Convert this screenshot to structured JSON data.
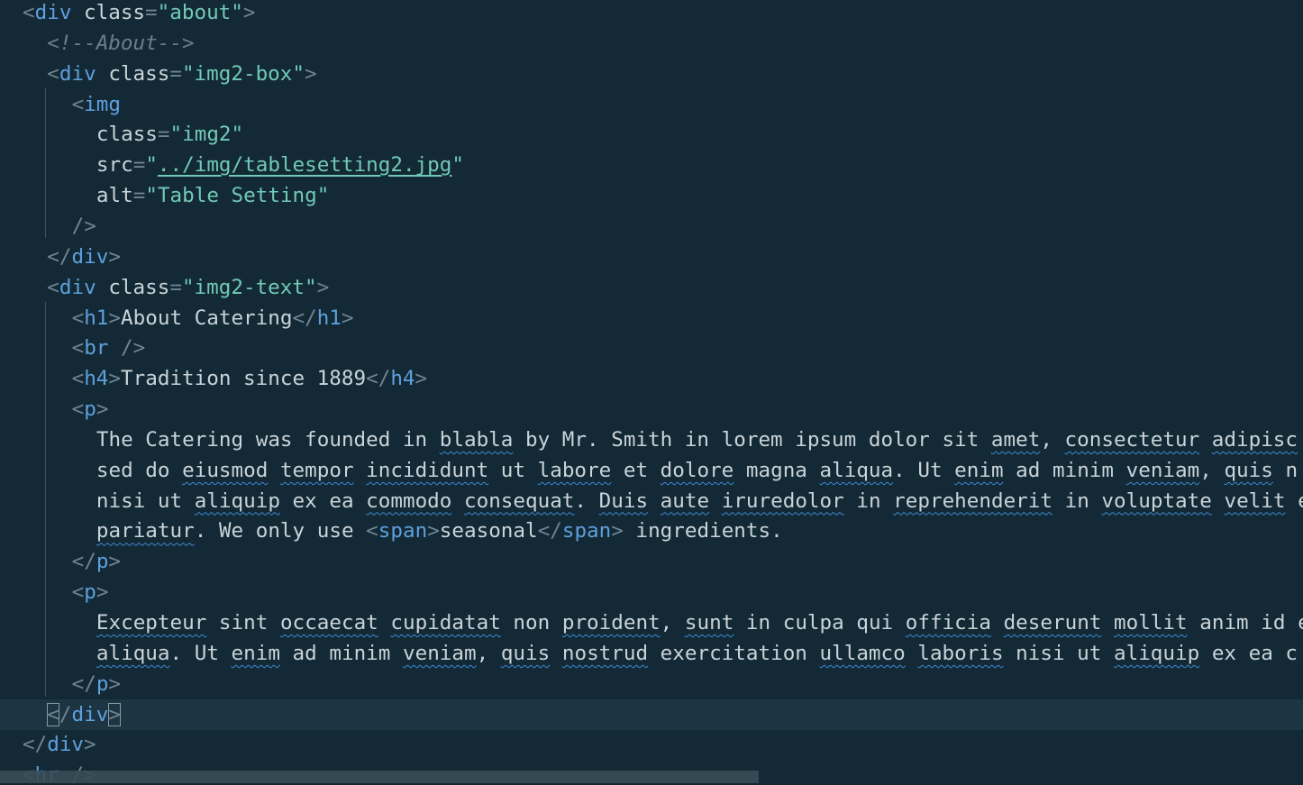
{
  "editor": {
    "language": "html",
    "colors": {
      "background": "#132935",
      "current_line": "#1d3443",
      "tag": "#5ea0dc",
      "string": "#71c9b6",
      "comment": "#6b7f89",
      "punctuation": "#6f8591",
      "text": "#c9d4d8",
      "spellcheck_squiggle": "#3d8bd6"
    },
    "lines": [
      {
        "indent": 0,
        "tokens": [
          [
            "pun",
            "<"
          ],
          [
            "tag",
            "div"
          ],
          [
            "attr",
            " class"
          ],
          [
            "pun",
            "="
          ],
          [
            "val",
            "\"about\""
          ],
          [
            "pun",
            ">"
          ]
        ]
      },
      {
        "indent": 1,
        "tokens": [
          [
            "cm",
            "<!--About-->"
          ]
        ]
      },
      {
        "indent": 1,
        "tokens": [
          [
            "pun",
            "<"
          ],
          [
            "tag",
            "div"
          ],
          [
            "attr",
            " class"
          ],
          [
            "pun",
            "="
          ],
          [
            "val",
            "\"img2-box\""
          ],
          [
            "pun",
            ">"
          ]
        ]
      },
      {
        "indent": 2,
        "tokens": [
          [
            "pun",
            "<"
          ],
          [
            "tag",
            "img"
          ]
        ]
      },
      {
        "indent": 3,
        "tokens": [
          [
            "attr",
            "class"
          ],
          [
            "pun",
            "="
          ],
          [
            "val",
            "\"img2\""
          ]
        ]
      },
      {
        "indent": 3,
        "tokens": [
          [
            "attr",
            "src"
          ],
          [
            "pun",
            "="
          ],
          [
            "val",
            "\""
          ],
          [
            "url",
            "../img/tablesetting2.jpg"
          ],
          [
            "val",
            "\""
          ]
        ]
      },
      {
        "indent": 3,
        "tokens": [
          [
            "attr",
            "alt"
          ],
          [
            "pun",
            "="
          ],
          [
            "val",
            "\"Table Setting\""
          ]
        ]
      },
      {
        "indent": 2,
        "tokens": [
          [
            "pun",
            "/>"
          ]
        ]
      },
      {
        "indent": 1,
        "tokens": [
          [
            "pun",
            "</"
          ],
          [
            "tag",
            "div"
          ],
          [
            "pun",
            ">"
          ]
        ]
      },
      {
        "indent": 1,
        "tokens": [
          [
            "pun",
            "<"
          ],
          [
            "tag",
            "div"
          ],
          [
            "attr",
            " class"
          ],
          [
            "pun",
            "="
          ],
          [
            "val",
            "\"img2-text\""
          ],
          [
            "pun",
            ">"
          ]
        ]
      },
      {
        "indent": 2,
        "tokens": [
          [
            "pun",
            "<"
          ],
          [
            "tag",
            "h1"
          ],
          [
            "pun",
            ">"
          ],
          [
            "txt",
            "About Catering"
          ],
          [
            "pun",
            "</"
          ],
          [
            "tag",
            "h1"
          ],
          [
            "pun",
            ">"
          ]
        ]
      },
      {
        "indent": 2,
        "tokens": [
          [
            "pun",
            "<"
          ],
          [
            "tag",
            "br"
          ],
          [
            "pun",
            " />"
          ]
        ]
      },
      {
        "indent": 2,
        "tokens": [
          [
            "pun",
            "<"
          ],
          [
            "tag",
            "h4"
          ],
          [
            "pun",
            ">"
          ],
          [
            "txt",
            "Tradition since 1889"
          ],
          [
            "pun",
            "</"
          ],
          [
            "tag",
            "h4"
          ],
          [
            "pun",
            ">"
          ]
        ]
      },
      {
        "indent": 2,
        "tokens": [
          [
            "pun",
            "<"
          ],
          [
            "tag",
            "p"
          ],
          [
            "pun",
            ">"
          ]
        ]
      },
      {
        "indent": 3,
        "tokens": [
          [
            "txt",
            "The Catering was founded in "
          ],
          [
            "sq",
            "blabla"
          ],
          [
            "txt",
            " by Mr. Smith in lorem ipsum dolor sit "
          ],
          [
            "sq",
            "amet"
          ],
          [
            "txt",
            ", "
          ],
          [
            "sq",
            "consectetur"
          ],
          [
            "txt",
            " "
          ],
          [
            "sq",
            "adipisc"
          ]
        ]
      },
      {
        "indent": 3,
        "tokens": [
          [
            "txt",
            "sed do "
          ],
          [
            "sq",
            "eiusmod"
          ],
          [
            "txt",
            " "
          ],
          [
            "sq",
            "tempor"
          ],
          [
            "txt",
            " "
          ],
          [
            "sq",
            "incididunt"
          ],
          [
            "txt",
            " ut "
          ],
          [
            "sq",
            "labore"
          ],
          [
            "txt",
            " et "
          ],
          [
            "sq",
            "dolore"
          ],
          [
            "txt",
            " magna "
          ],
          [
            "sq",
            "aliqua"
          ],
          [
            "txt",
            ". Ut "
          ],
          [
            "sq",
            "enim"
          ],
          [
            "txt",
            " ad minim "
          ],
          [
            "sq",
            "veniam"
          ],
          [
            "txt",
            ", "
          ],
          [
            "sq",
            "quis"
          ],
          [
            "txt",
            " n"
          ]
        ]
      },
      {
        "indent": 3,
        "tokens": [
          [
            "txt",
            "nisi ut "
          ],
          [
            "sq",
            "aliquip"
          ],
          [
            "txt",
            " ex ea "
          ],
          [
            "sq",
            "commodo"
          ],
          [
            "txt",
            " "
          ],
          [
            "sq",
            "consequat"
          ],
          [
            "txt",
            ". "
          ],
          [
            "sq",
            "Duis"
          ],
          [
            "txt",
            " "
          ],
          [
            "sq",
            "aute"
          ],
          [
            "txt",
            " "
          ],
          [
            "sq",
            "iruredolor"
          ],
          [
            "txt",
            " in "
          ],
          [
            "sq",
            "reprehenderit"
          ],
          [
            "txt",
            " in "
          ],
          [
            "sq",
            "voluptate"
          ],
          [
            "txt",
            " "
          ],
          [
            "sq",
            "velit"
          ],
          [
            "txt",
            " e"
          ]
        ]
      },
      {
        "indent": 3,
        "tokens": [
          [
            "sq",
            "pariatur"
          ],
          [
            "txt",
            ". We only use "
          ],
          [
            "pun",
            "<"
          ],
          [
            "tag",
            "span"
          ],
          [
            "pun",
            ">"
          ],
          [
            "txt",
            "seasonal"
          ],
          [
            "pun",
            "</"
          ],
          [
            "tag",
            "span"
          ],
          [
            "pun",
            ">"
          ],
          [
            "txt",
            " ingredients."
          ]
        ]
      },
      {
        "indent": 2,
        "tokens": [
          [
            "pun",
            "</"
          ],
          [
            "tag",
            "p"
          ],
          [
            "pun",
            ">"
          ]
        ]
      },
      {
        "indent": 2,
        "tokens": [
          [
            "pun",
            "<"
          ],
          [
            "tag",
            "p"
          ],
          [
            "pun",
            ">"
          ]
        ]
      },
      {
        "indent": 3,
        "tokens": [
          [
            "sq",
            "Excepteur"
          ],
          [
            "txt",
            " sint "
          ],
          [
            "sq",
            "occaecat"
          ],
          [
            "txt",
            " "
          ],
          [
            "sq",
            "cupidatat"
          ],
          [
            "txt",
            " non "
          ],
          [
            "sq",
            "proident"
          ],
          [
            "txt",
            ", "
          ],
          [
            "sq",
            "sunt"
          ],
          [
            "txt",
            " in culpa qui "
          ],
          [
            "sq",
            "officia"
          ],
          [
            "txt",
            " "
          ],
          [
            "sq",
            "deserunt"
          ],
          [
            "txt",
            " "
          ],
          [
            "sq",
            "mollit"
          ],
          [
            "txt",
            " anim id e"
          ]
        ]
      },
      {
        "indent": 3,
        "tokens": [
          [
            "sq",
            "aliqua"
          ],
          [
            "txt",
            ". Ut "
          ],
          [
            "sq",
            "enim"
          ],
          [
            "txt",
            " ad minim "
          ],
          [
            "sq",
            "veniam"
          ],
          [
            "txt",
            ", "
          ],
          [
            "sq",
            "quis"
          ],
          [
            "txt",
            " "
          ],
          [
            "sq",
            "nostrud"
          ],
          [
            "txt",
            " exercitation "
          ],
          [
            "sq",
            "ullamco"
          ],
          [
            "txt",
            " "
          ],
          [
            "sq",
            "laboris"
          ],
          [
            "txt",
            " nisi ut "
          ],
          [
            "sq",
            "aliquip"
          ],
          [
            "txt",
            " ex ea c"
          ]
        ]
      },
      {
        "indent": 2,
        "tokens": [
          [
            "pun",
            "</"
          ],
          [
            "tag",
            "p"
          ],
          [
            "pun",
            ">"
          ]
        ]
      },
      {
        "indent": 1,
        "current": true,
        "tokens": [
          [
            "bm",
            "<"
          ],
          [
            "pun",
            "/"
          ],
          [
            "tag",
            "div"
          ],
          [
            "bm",
            ">"
          ]
        ]
      },
      {
        "indent": 0,
        "tokens": [
          [
            "pun",
            "</"
          ],
          [
            "tag",
            "div"
          ],
          [
            "pun",
            ">"
          ]
        ]
      },
      {
        "indent": 0,
        "tokens": [
          [
            "pun",
            "<"
          ],
          [
            "tag",
            "hr"
          ],
          [
            "pun",
            " />"
          ]
        ]
      }
    ]
  }
}
